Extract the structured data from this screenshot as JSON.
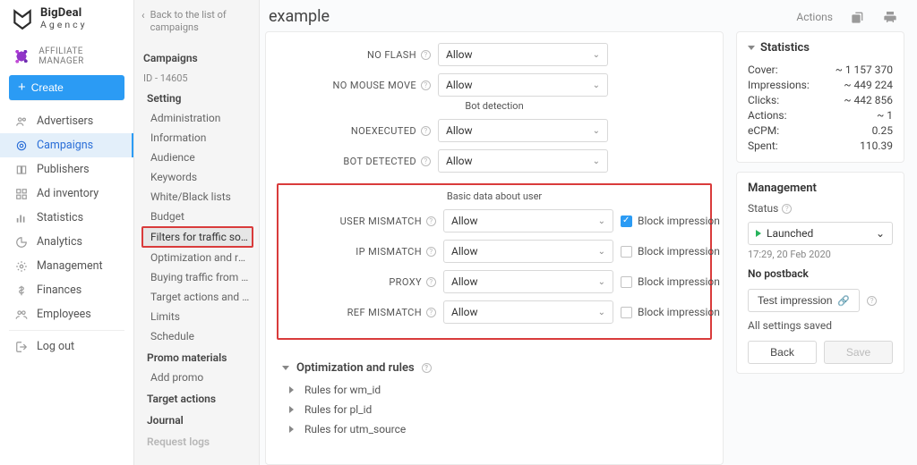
{
  "brand": {
    "line1": "BigDeal",
    "line2": "Agency"
  },
  "role_label": "AFFILIATE MANAGER",
  "create_label": "Create",
  "nav": {
    "items": [
      {
        "key": "advertisers",
        "label": "Advertisers"
      },
      {
        "key": "campaigns",
        "label": "Campaigns",
        "active": true
      },
      {
        "key": "publishers",
        "label": "Publishers"
      },
      {
        "key": "adinventory",
        "label": "Ad inventory"
      },
      {
        "key": "statistics",
        "label": "Statistics"
      },
      {
        "key": "analytics",
        "label": "Analytics"
      },
      {
        "key": "management",
        "label": "Management"
      },
      {
        "key": "finances",
        "label": "Finances"
      },
      {
        "key": "employees",
        "label": "Employees"
      }
    ],
    "logout": "Log out"
  },
  "subnav": {
    "back": "Back to the list of campaigns",
    "heading": "Campaigns",
    "id": "ID - 14605",
    "setting_heading": "Setting",
    "settings": [
      "Administration",
      "Information",
      "Audience",
      "Keywords",
      "White/Black lists",
      "Budget",
      "Filters for traffic sour...",
      "Optimization and rules",
      "Buying traffic from S...",
      "Target actions and re...",
      "Limits",
      "Schedule"
    ],
    "settings_selected_index": 6,
    "promo_heading": "Promo materials",
    "promo_add": "Add promo",
    "target_actions_heading": "Target actions",
    "journal_heading": "Journal",
    "request_logs_heading": "Request logs"
  },
  "header": {
    "title": "example",
    "actions": "Actions"
  },
  "filters": {
    "section_bot": "Bot detection",
    "section_basic": "Basic data about user",
    "rows": {
      "no_flash": {
        "label": "NO FLASH",
        "value": "Allow",
        "block": null
      },
      "no_mouse_move": {
        "label": "NO MOUSE MOVE",
        "value": "Allow",
        "block": null
      },
      "noexecuted": {
        "label": "NOEXECUTED",
        "value": "Allow",
        "block": null
      },
      "bot_detected": {
        "label": "BOT DETECTED",
        "value": "Allow",
        "block": null
      },
      "user_mismatch": {
        "label": "USER MISMATCH",
        "value": "Allow",
        "block": true
      },
      "ip_mismatch": {
        "label": "IP MISMATCH",
        "value": "Allow",
        "block": false
      },
      "proxy": {
        "label": "PROXY",
        "value": "Allow",
        "block": false
      },
      "ref_mismatch": {
        "label": "REF MISMATCH",
        "value": "Allow",
        "block": false
      }
    },
    "block_label": "Block impression"
  },
  "rules": {
    "heading": "Optimization and rules",
    "items": [
      "Rules for wm_id",
      "Rules for pl_id",
      "Rules for utm_source"
    ]
  },
  "stats": {
    "heading": "Statistics",
    "rows": [
      {
        "k": "Cover:",
        "v": "~ 1 157 370"
      },
      {
        "k": "Impressions:",
        "v": "~ 449 224"
      },
      {
        "k": "Clicks:",
        "v": "~ 442 856"
      },
      {
        "k": "Actions:",
        "v": "~ 1"
      },
      {
        "k": "eCPM:",
        "v": "0.25"
      },
      {
        "k": "Spent:",
        "v": "110.39"
      }
    ]
  },
  "management": {
    "heading": "Management",
    "status_label": "Status",
    "status_value": "Launched",
    "timestamp": "17:29, 20 Feb 2020",
    "no_postback": "No postback",
    "test_btn": "Test impression",
    "saved_msg": "All settings saved",
    "back": "Back",
    "save": "Save"
  }
}
